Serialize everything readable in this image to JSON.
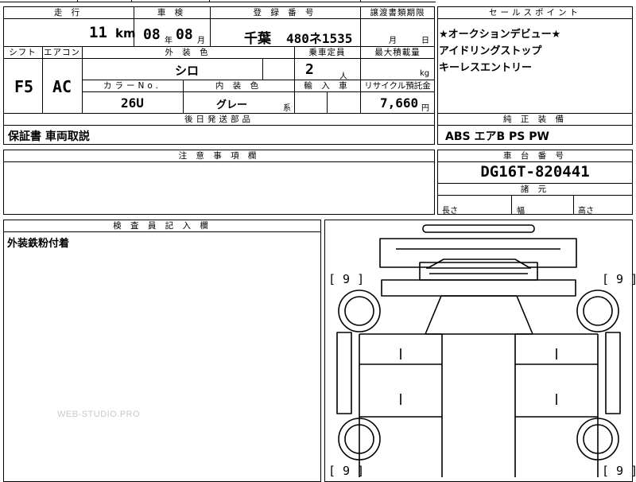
{
  "headers": {
    "mileage": "走 行",
    "inspection": "車 検",
    "registration": "登 録 番 号",
    "transfer_deadline": "譲渡書類期限",
    "sales_point": "セールスポイント",
    "shift": "シフト",
    "aircon": "エアコン",
    "exterior_color": "外 装 色",
    "capacity": "乗車定員",
    "max_load": "最大積載量",
    "color_no": "カラーNo.",
    "interior_color": "内 装 色",
    "import": "輸 入 車",
    "recycle": "リサイクル預託金",
    "post_parts": "後日発送部品",
    "equipment": "純 正 装 備",
    "notes": "注 意 事 項 欄",
    "chassis": "車 台 番 号",
    "dimensions": "諸 元",
    "inspector": "検 査 員 記 入 欄"
  },
  "values": {
    "mileage_num": "11",
    "mileage_unit": "km",
    "inspection_year": "08",
    "year_unit": "年",
    "inspection_month": "08",
    "month_unit": "月",
    "plate_region": "千葉",
    "plate_number": "480ネ1535",
    "transfer_month_unit": "月",
    "transfer_day_unit": "日",
    "shift": "F5",
    "aircon": "AC",
    "exterior_color": "シロ",
    "capacity": "2",
    "capacity_unit": "人",
    "load_unit": "kg",
    "color_no": "26U",
    "interior_color": "グレー",
    "interior_suffix": "系",
    "recycle_fee": "7,660",
    "recycle_unit": "円",
    "post_parts": "保証書 車両取説",
    "equipment": "ABS エアB PS PW",
    "chassis_number": "DG16T-820441",
    "dim_length": "長さ",
    "dim_width": "幅",
    "dim_height": "高さ",
    "inspector_note": "外装鉄粉付着"
  },
  "sales_points": [
    "★オークションデビュー★",
    "アイドリングストップ",
    "キーレスエントリー"
  ],
  "diagram_marks": {
    "front_left": "[ 9 ]",
    "front_right": "[ 9 ]",
    "rear_left": "[ 9 ]",
    "rear_right": "[ 9 ]"
  },
  "watermark": "WEB-STUDIO.PRO"
}
